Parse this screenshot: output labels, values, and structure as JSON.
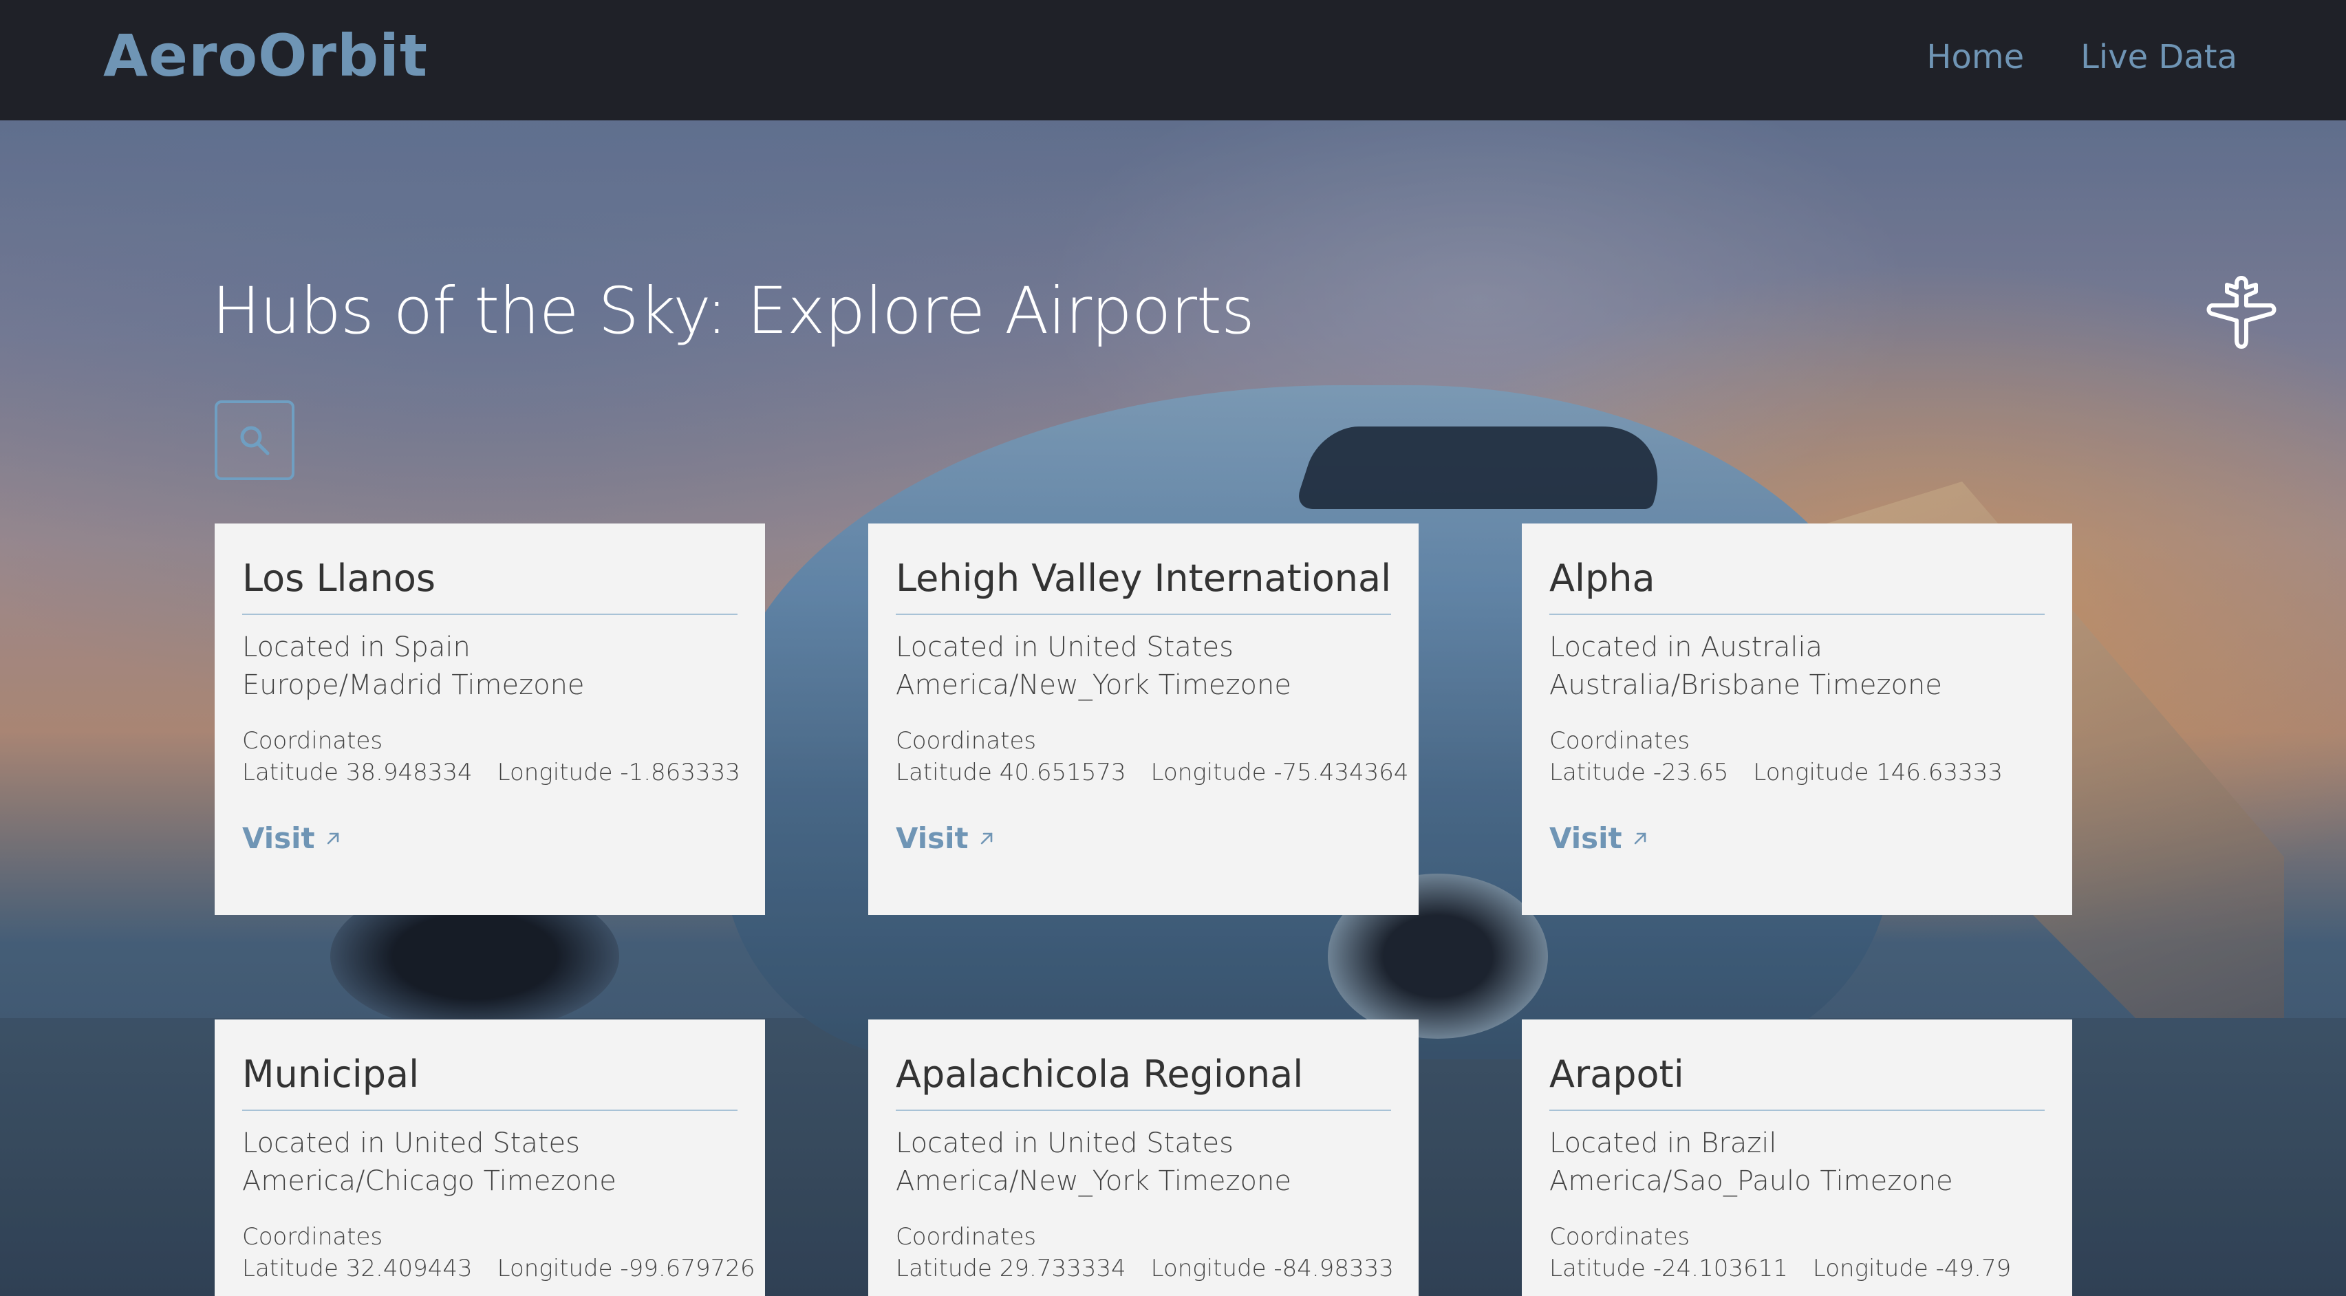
{
  "header": {
    "logo": "AeroOrbit",
    "nav": [
      {
        "label": "Home"
      },
      {
        "label": "Live Data"
      }
    ]
  },
  "hero": {
    "title": "Hubs of the Sky: Explore Airports",
    "icon": "airplane-icon",
    "search_icon": "search-icon"
  },
  "cards": [
    {
      "name": "Los Llanos",
      "country": "Located in Spain",
      "timezone": "Europe/Madrid Timezone",
      "coords_label": "Coordinates",
      "latitude": "Latitude 38.948334",
      "longitude": "Longitude -1.863333",
      "visit": "Visit"
    },
    {
      "name": "Lehigh Valley International",
      "country": "Located in United States",
      "timezone": "America/New_York Timezone",
      "coords_label": "Coordinates",
      "latitude": "Latitude 40.651573",
      "longitude": "Longitude -75.434364",
      "visit": "Visit"
    },
    {
      "name": "Alpha",
      "country": "Located in Australia",
      "timezone": "Australia/Brisbane Timezone",
      "coords_label": "Coordinates",
      "latitude": "Latitude -23.65",
      "longitude": "Longitude 146.63333",
      "visit": "Visit"
    },
    {
      "name": "Municipal",
      "country": "Located in United States",
      "timezone": "America/Chicago Timezone",
      "coords_label": "Coordinates",
      "latitude": "Latitude 32.409443",
      "longitude": "Longitude -99.679726"
    },
    {
      "name": "Apalachicola Regional",
      "country": "Located in United States",
      "timezone": "America/New_York Timezone",
      "coords_label": "Coordinates",
      "latitude": "Latitude 29.733334",
      "longitude": "Longitude -84.98333"
    },
    {
      "name": "Arapoti",
      "country": "Located in Brazil",
      "timezone": "America/Sao_Paulo Timezone",
      "coords_label": "Coordinates",
      "latitude": "Latitude -24.103611",
      "longitude": "Longitude -49.79"
    }
  ],
  "colors": {
    "accent": "#6f95b5",
    "header_bg": "#1f2128",
    "card_bg": "#f3f3f3"
  }
}
